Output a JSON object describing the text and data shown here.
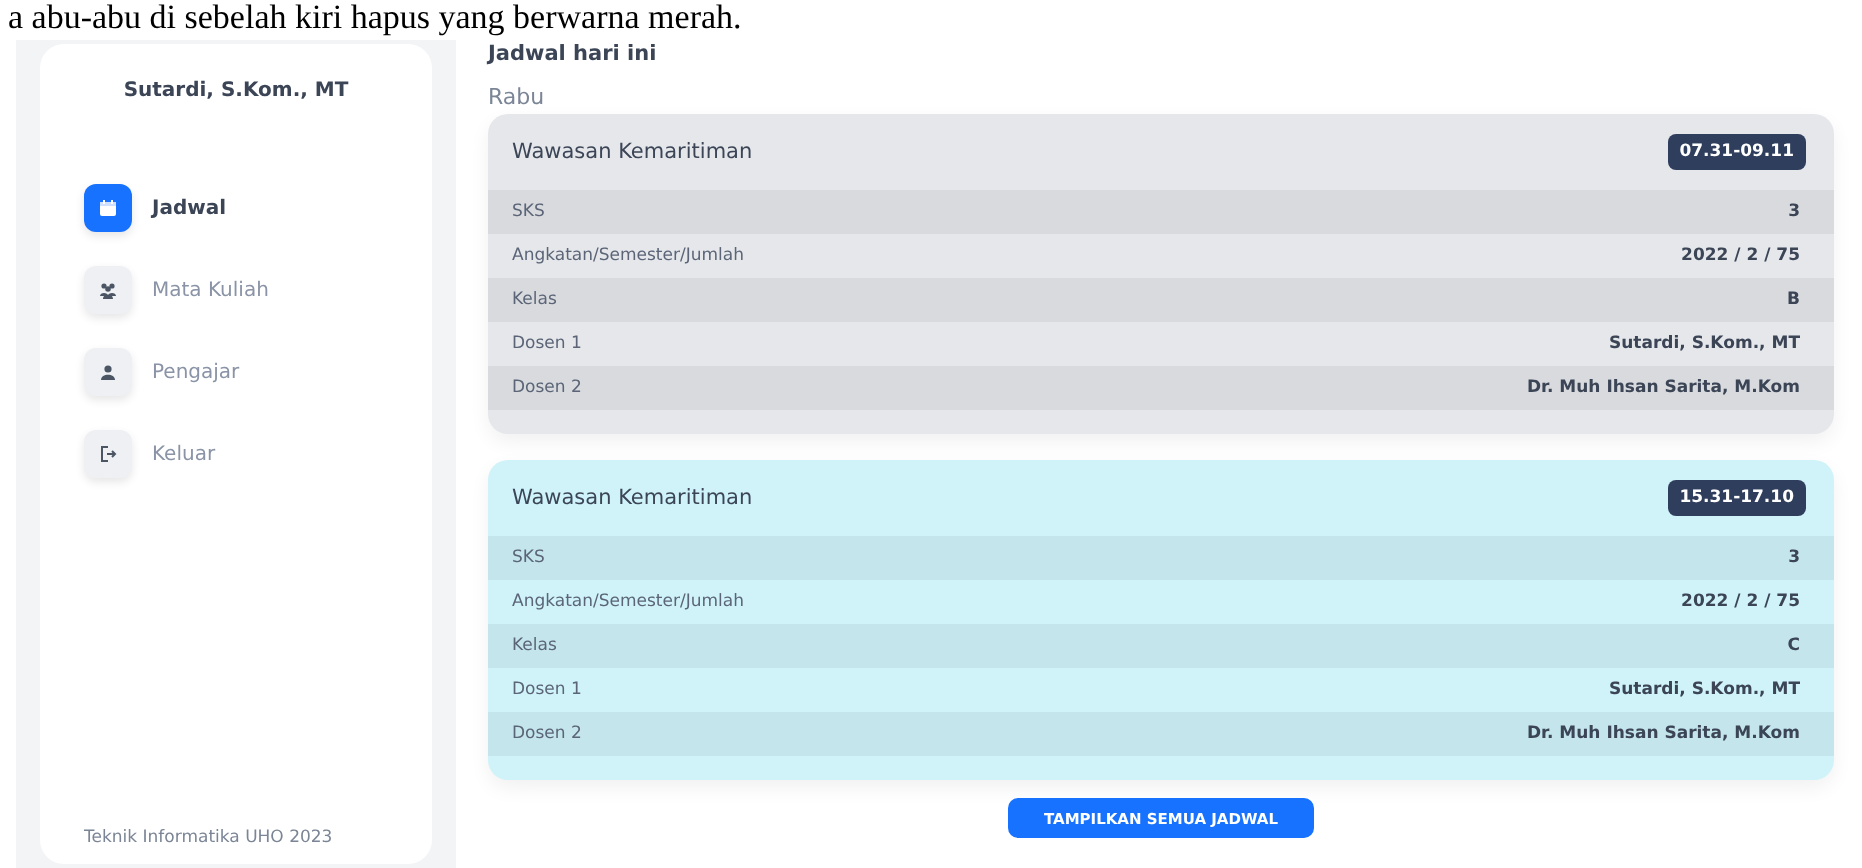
{
  "document_text": "a abu-abu di sebelah kiri hapus yang berwarna merah.",
  "sidebar": {
    "user_name": "Sutardi, S.Kom., MT",
    "items": [
      {
        "label": "Jadwal",
        "selected": true
      },
      {
        "label": "Mata Kuliah",
        "selected": false
      },
      {
        "label": "Pengajar",
        "selected": false
      },
      {
        "label": "Keluar",
        "selected": false
      }
    ],
    "footer": "Teknik Informatika UHO 2023"
  },
  "main": {
    "heading": "Jadwal hari ini",
    "day": "Rabu",
    "schedules": [
      {
        "course": "Wawasan Kemaritiman",
        "time": "07.31-09.11",
        "color": "#e5e7eb",
        "rows": [
          {
            "label": "SKS",
            "value": "3"
          },
          {
            "label": "Angkatan/Semester/Jumlah",
            "value": "2022 / 2 / 75"
          },
          {
            "label": "Kelas",
            "value": "B"
          },
          {
            "label": "Dosen 1",
            "value": "Sutardi, S.Kom., MT"
          },
          {
            "label": "Dosen 2",
            "value": "Dr. Muh Ihsan Sarita, M.Kom"
          }
        ]
      },
      {
        "course": "Wawasan Kemaritiman",
        "time": "15.31-17.10",
        "color": "#cff3f9",
        "rows": [
          {
            "label": "SKS",
            "value": "3"
          },
          {
            "label": "Angkatan/Semester/Jumlah",
            "value": "2022 / 2 / 75"
          },
          {
            "label": "Kelas",
            "value": "C"
          },
          {
            "label": "Dosen 1",
            "value": "Sutardi, S.Kom., MT"
          },
          {
            "label": "Dosen 2",
            "value": "Dr. Muh Ihsan Sarita, M.Kom"
          }
        ]
      }
    ],
    "button": "TAMPILKAN SEMUA JADWAL"
  }
}
